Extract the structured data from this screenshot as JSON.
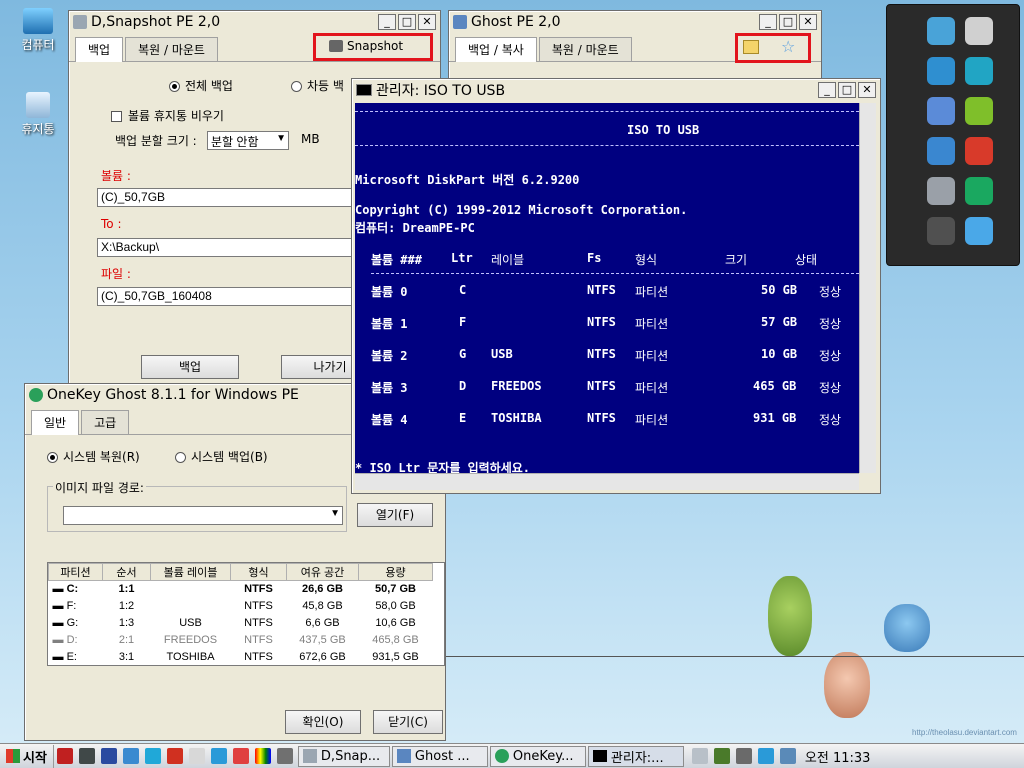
{
  "desktop": {
    "icons": [
      {
        "label": "컴퓨터",
        "icon": "computer-icon"
      },
      {
        "label": "휴지통",
        "icon": "recycle-bin-icon"
      }
    ],
    "watermark": "http://theolasu.deviantart.com"
  },
  "snapshot_window": {
    "title": "D,Snapshot PE 2,0",
    "tabs": [
      "백업",
      "복원 / 마운트"
    ],
    "snapshot_button": "Snapshot",
    "radio_full": "전체 백업",
    "radio_diff": "차등 백",
    "empty_recycle": "볼륨 휴지통 비우기",
    "split_label": "백업 분할 크기 :",
    "split_value": "분할 안함",
    "split_unit": "MB",
    "volume_label": "볼륨 :",
    "volume_value": "(C)_50,7GB",
    "to_label": "To :",
    "to_value": "X:\\Backup\\",
    "file_label": "파일 :",
    "file_value": "(C)_50,7GB_160408",
    "backup_button": "백업",
    "exit_button": "나가기"
  },
  "ghost_window": {
    "title": "Ghost PE 2,0",
    "tabs": [
      "백업 / 복사",
      "복원 / 마운트"
    ]
  },
  "console_window": {
    "title": "관리자:  ISO TO USB",
    "header": "ISO TO USB",
    "version_line": "Microsoft DiskPart 버전 6.2.9200",
    "copyright_line": "Copyright (C) 1999-2012 Microsoft Corporation.",
    "computer_line": "컴퓨터: DreamPE-PC",
    "columns": [
      "볼륨 ###",
      "Ltr",
      "레이블",
      "Fs",
      "형식",
      "크기",
      "상태"
    ],
    "rows": [
      {
        "vol": "볼륨 0",
        "ltr": "C",
        "label": "",
        "fs": "NTFS",
        "type": "파티션",
        "size": "50 GB",
        "status": "정상"
      },
      {
        "vol": "볼륨 1",
        "ltr": "F",
        "label": "",
        "fs": "NTFS",
        "type": "파티션",
        "size": "57 GB",
        "status": "정상"
      },
      {
        "vol": "볼륨 2",
        "ltr": "G",
        "label": "USB",
        "fs": "NTFS",
        "type": "파티션",
        "size": "10 GB",
        "status": "정상"
      },
      {
        "vol": "볼륨 3",
        "ltr": "D",
        "label": "FREEDOS",
        "fs": "NTFS",
        "type": "파티션",
        "size": "465 GB",
        "status": "정상"
      },
      {
        "vol": "볼륨 4",
        "ltr": "E",
        "label": "TOSHIBA",
        "fs": "NTFS",
        "type": "파티션",
        "size": "931 GB",
        "status": "정상"
      }
    ],
    "prompt": "* ISO Ltr 문자를 입력하세요."
  },
  "onekey_window": {
    "title": "OneKey Ghost 8.1.1 for Windows PE",
    "tabs": [
      "일반",
      "고급"
    ],
    "radio_restore": "시스템 복원(R)",
    "radio_backup": "시스템 백업(B)",
    "image_path_label": "이미지 파일 경로:",
    "open_button": "열기(F)",
    "table_headers": [
      "파티션",
      "순서",
      "볼륨 레이블",
      "형식",
      "여유 공간",
      "용량"
    ],
    "table_rows": [
      {
        "part": "C:",
        "order": "1:1",
        "label": "",
        "fs": "NTFS",
        "free": "26,6 GB",
        "cap": "50,7 GB"
      },
      {
        "part": "F:",
        "order": "1:2",
        "label": "",
        "fs": "NTFS",
        "free": "45,8 GB",
        "cap": "58,0 GB"
      },
      {
        "part": "G:",
        "order": "1:3",
        "label": "USB",
        "fs": "NTFS",
        "free": "6,6 GB",
        "cap": "10,6 GB"
      },
      {
        "part": "D:",
        "order": "2:1",
        "label": "FREEDOS",
        "fs": "NTFS",
        "free": "437,5 GB",
        "cap": "465,8 GB"
      },
      {
        "part": "E:",
        "order": "3:1",
        "label": "TOSHIBA",
        "fs": "NTFS",
        "free": "672,6 GB",
        "cap": "931,5 GB"
      }
    ],
    "ok_button": "확인(O)",
    "close_button": "닫기(C)"
  },
  "taskbar": {
    "start_label": "시작",
    "tasks": [
      "D,Snap...",
      "Ghost ...",
      "OneKey...",
      "관리자:..."
    ],
    "clock": "오전 11:33"
  },
  "colors": {
    "highlight": "#e2141c",
    "console_bg": "#000080"
  }
}
